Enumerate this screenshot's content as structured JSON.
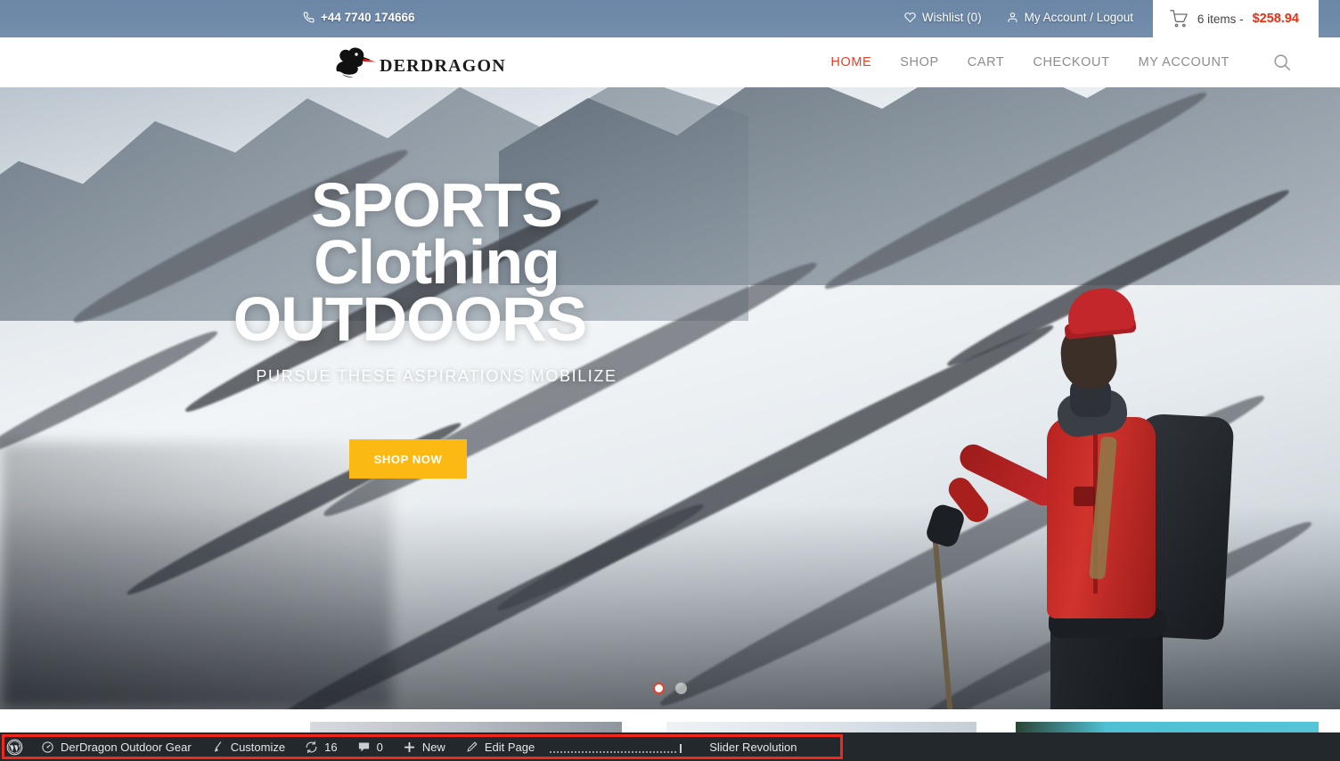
{
  "topbar": {
    "phone_icon": "phone-icon",
    "phone": "+44 7740 174666",
    "wishlist_icon": "heart-icon",
    "wishlist": "Wishlist (0)",
    "account_icon": "user-icon",
    "account": "My Account / Logout",
    "cart_icon": "shopping-cart-icon",
    "cart_items": "6 items - ",
    "cart_total": "$258.94",
    "cart_total_color": "#f02b10"
  },
  "header": {
    "logo_icon": "dragon-logo-icon",
    "logo_text": "DERDRAGON",
    "search_icon": "search-icon",
    "menu": [
      {
        "label": "HOME",
        "active": true
      },
      {
        "label": "SHOP",
        "active": false
      },
      {
        "label": "CART",
        "active": false
      },
      {
        "label": "CHECKOUT",
        "active": false
      },
      {
        "label": "MY ACCOUNT",
        "active": false
      }
    ],
    "active_color": "#ef3c25",
    "inactive_color": "#8d8d8d"
  },
  "hero": {
    "line1": "SPORTS",
    "line2": "Clothing",
    "line3": "OUTDOORS",
    "subtitle": "PURSUE THESE ASPIRATIONS MOBILIZE",
    "cta_label": "SHOP NOW",
    "cta_color": "#fdb913",
    "slide_current": 1,
    "slide_total": 2,
    "scene": "hiker in red jacket and red beanie on snowy mountain slope"
  },
  "adminbar": {
    "background": "#23282d",
    "highlight_color": "#f1271b",
    "wp_logo_icon": "wordpress-icon",
    "items": [
      {
        "icon": "dashboard-icon",
        "label": "DerDragon Outdoor Gear"
      },
      {
        "icon": "paintbrush-icon",
        "label": "Customize"
      },
      {
        "icon": "updates-icon",
        "label": "16"
      },
      {
        "icon": "comment-icon",
        "label": "0"
      },
      {
        "icon": "plus-icon",
        "label": "New"
      },
      {
        "icon": "pencil-icon",
        "label": "Edit Page"
      }
    ],
    "slider_revolution": "Slider Revolution"
  }
}
